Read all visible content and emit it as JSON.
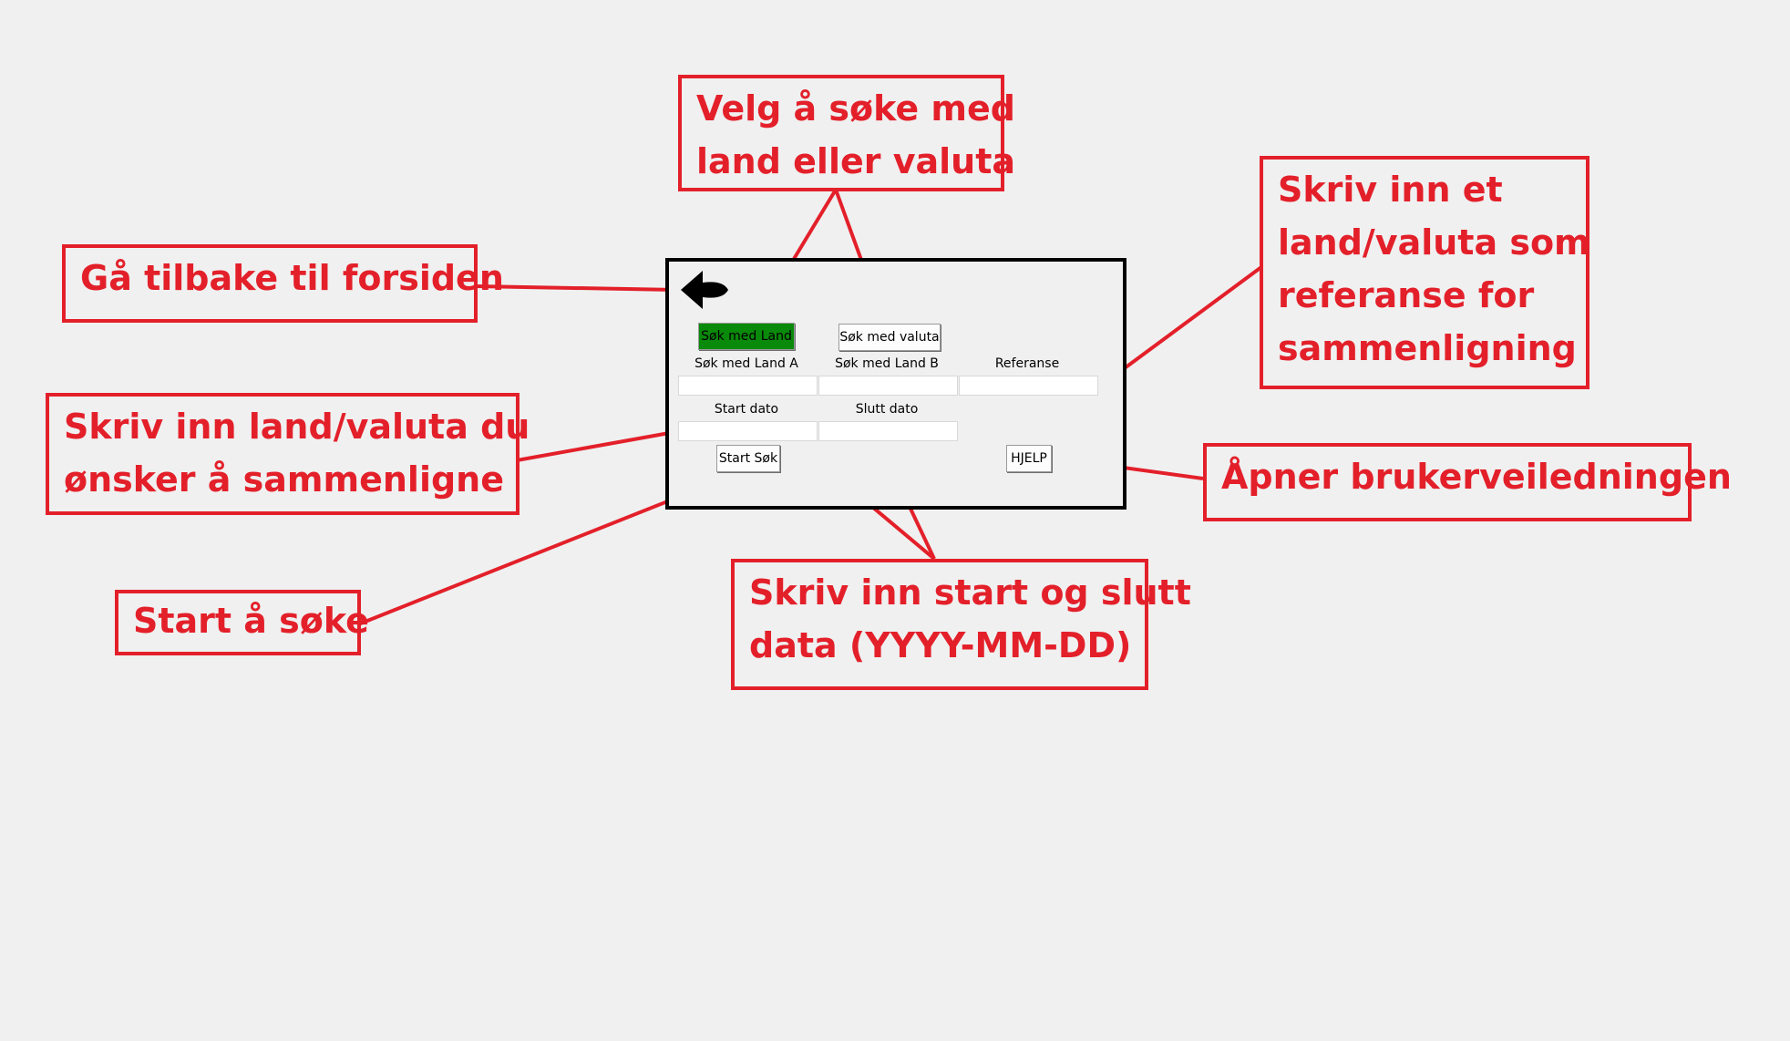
{
  "callouts": {
    "back": "Gå tilbake til forsiden",
    "mode_line1": "Velg å søke med",
    "mode_line2": "land eller valuta",
    "reference_line1": "Skriv inn et",
    "reference_line2": "land/valuta som",
    "reference_line3": "referanse for",
    "reference_line4": "sammenligning",
    "compare_line1": "Skriv inn land/valuta du",
    "compare_line2": "ønsker å sammenligne",
    "help": "Åpner brukerveiledningen",
    "start_search": "Start å søke",
    "dates_line1": "Skriv inn start og slutt",
    "dates_line2": "data (YYYY-MM-DD)"
  },
  "app": {
    "btn_country": "Søk med Land",
    "btn_currency": "Søk med valuta",
    "label_a": "Søk med Land A",
    "label_b": "Søk med Land B",
    "label_ref": "Referanse",
    "label_start": "Start dato",
    "label_end": "Slutt dato",
    "btn_start": "Start Søk",
    "btn_help": "HJELP",
    "value_a": "",
    "value_b": "",
    "value_ref": "",
    "value_start": "",
    "value_end": ""
  },
  "icons": {
    "back": "back-arrow-icon"
  },
  "colors": {
    "annotation": "#e3202a",
    "active_button": "#0a8a0a",
    "background": "#f0f0f0"
  }
}
